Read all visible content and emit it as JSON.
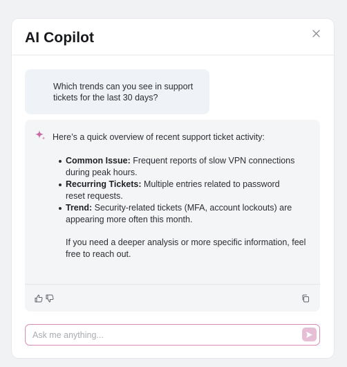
{
  "header": {
    "title": "AI Copilot",
    "close_icon": "close-icon"
  },
  "user_message": {
    "text": "Which trends can you see in support tickets for the last 30 days?"
  },
  "assistant_message": {
    "icon": "sparkle-icon",
    "intro": "Here’s a quick overview of recent support ticket activity:",
    "bullets": [
      {
        "label": "Common Issue:",
        "text": " Frequent reports of slow VPN connections during peak hours."
      },
      {
        "label": "Recurring Tickets:",
        "text": " Multiple entries related to password reset requests."
      },
      {
        "label": "Trend:",
        "text": " Security-related tickets (MFA, account lockouts) are appearing more often this month."
      }
    ],
    "outro": "If you need a deeper analysis or more specific information, feel free to reach out.",
    "actions": [
      "thumbs-up-icon",
      "thumbs-down-icon",
      "copy-icon"
    ]
  },
  "composer": {
    "placeholder": "Ask me anything...",
    "value": "",
    "send_icon": "send-icon"
  },
  "colors": {
    "accent": "#d98ab5",
    "send_bg": "#e6bed6",
    "user_bubble": "#eff3f8",
    "assistant_bubble": "#f4f5f7"
  }
}
